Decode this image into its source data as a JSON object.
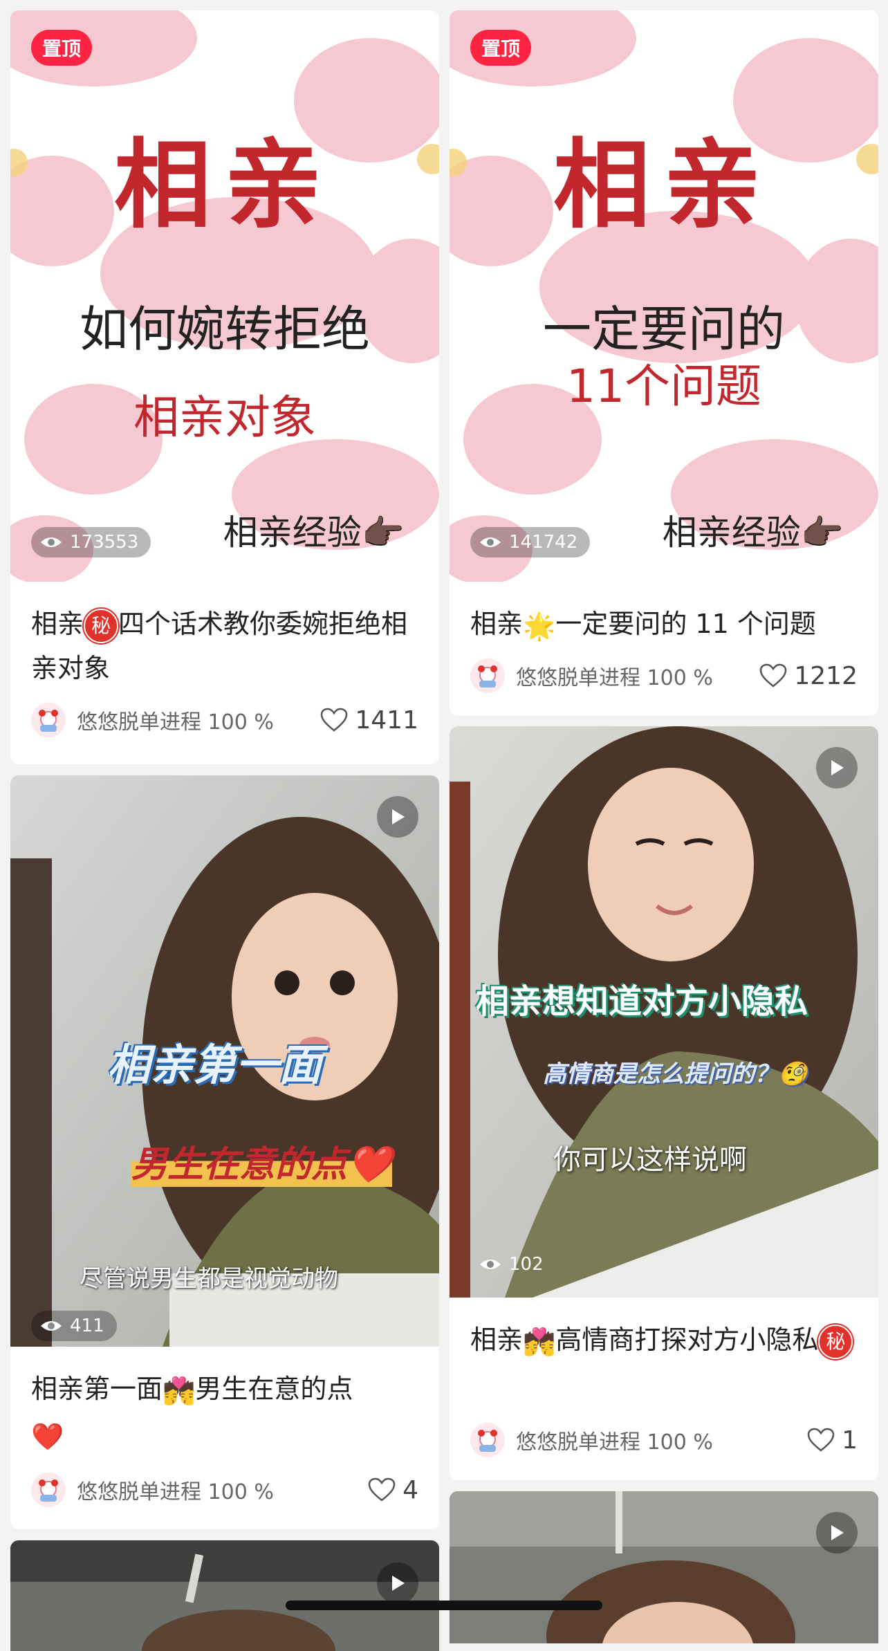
{
  "cards": [
    {
      "pin_label": "置顶",
      "cover_lines": [
        "相亲",
        "如何婉转拒绝",
        "相亲对象",
        "相亲经验👉🏿"
      ],
      "views": "173553",
      "title_prefix": "相亲",
      "title_badge": "秘",
      "title_rest": "四个话术教你委婉拒绝相亲对象",
      "author": "悠悠脱单进程 100 %",
      "likes": "1411"
    },
    {
      "pin_label": "置顶",
      "cover_lines": [
        "相亲",
        "一定要问的",
        "11个问题",
        "相亲经验👉🏿"
      ],
      "views": "141742",
      "title_prefix": "相亲",
      "title_emoji": "🌟",
      "title_rest": "一定要问的 11 个问题",
      "author": "悠悠脱单进程 100 %",
      "likes": "1212"
    },
    {
      "cover_lines": [
        "相亲第一面",
        "男生在意的点❤️",
        "尽管说男生都是视觉动物"
      ],
      "views": "411",
      "title_prefix": "相亲第一面",
      "title_emoji": "💏",
      "title_rest": "男生在意的点",
      "title_tail": "❤️",
      "author": "悠悠脱单进程 100 %",
      "likes": "4"
    },
    {
      "cover_lines": [
        "相亲想知道对方小隐私",
        "高情商是怎么提问的？🧐",
        "你可以这样说啊"
      ],
      "views": "102",
      "title_prefix": "相亲",
      "title_emoji": "💏",
      "title_rest": "高情商打探对方小隐私",
      "title_badge": "秘",
      "author": "悠悠脱单进程 100 %",
      "likes": "1"
    }
  ],
  "colors": {
    "accent": "#ff2442",
    "cover_red": "#c1272d",
    "pink_blob": "#f6c9d2"
  }
}
